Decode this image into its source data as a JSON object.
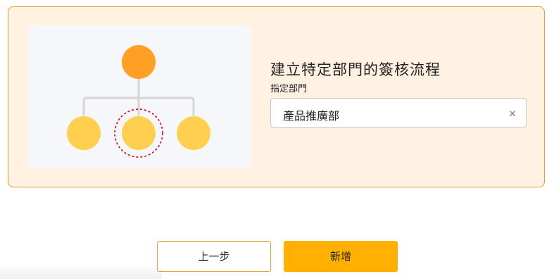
{
  "card": {
    "title": "建立特定部門的簽核流程",
    "field_label": "指定部門",
    "department_value": "產品推廣部"
  },
  "illustration": {
    "icon": "org-chart-icon",
    "colors": {
      "root_node": "#ffa024",
      "child_node": "#ffd04f",
      "connector": "#d5d5d5",
      "highlight_ring": "#d0021b"
    }
  },
  "buttons": {
    "back_label": "上一步",
    "add_label": "新增"
  },
  "colors": {
    "card_bg": "#fff2e2",
    "card_border": "#e49a2c",
    "primary": "#ffb000"
  }
}
